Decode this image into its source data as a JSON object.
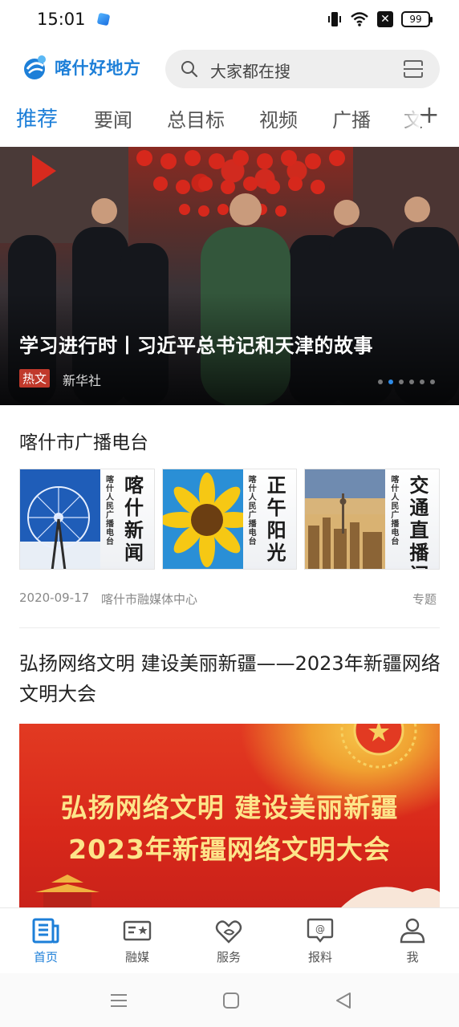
{
  "status_bar": {
    "time": "15:01",
    "battery": "99"
  },
  "header": {
    "logo_text": "喀什好地方",
    "search_placeholder": "大家都在搜"
  },
  "tabs": [
    {
      "label": "推荐",
      "active": true
    },
    {
      "label": "要闻"
    },
    {
      "label": "总目标"
    },
    {
      "label": "视频"
    },
    {
      "label": "广播"
    },
    {
      "label": "文"
    }
  ],
  "tab_add_label": "+",
  "banner": {
    "title": "学习进行时丨习近平总书记和天津的故事",
    "tag": "热文",
    "source": "新华社",
    "dot_count": 6,
    "active_dot": 1
  },
  "radio_section": {
    "title": "喀什市广播电台",
    "cards": [
      {
        "station": "喀什人民广播电台",
        "program": "喀什新闻",
        "icon": "ferris-wheel"
      },
      {
        "station": "喀什人民广播电台",
        "program": "正午阳光",
        "icon": "sunflower"
      },
      {
        "station": "喀什人民广播电台",
        "program": "交通直播间",
        "icon": "city-skyline"
      }
    ],
    "date": "2020-09-17",
    "org": "喀什市融媒体中心",
    "type": "专题"
  },
  "article": {
    "title": "弘扬网络文明 建设美丽新疆——2023年新疆网络文明大会",
    "image_line1": "弘扬网络文明 建设美丽新疆",
    "image_line2": "2023年新疆网络文明大会"
  },
  "bottom_nav": [
    {
      "label": "首页",
      "icon": "home-news-icon",
      "active": true
    },
    {
      "label": "融媒",
      "icon": "media-card-icon"
    },
    {
      "label": "服务",
      "icon": "service-heart-icon"
    },
    {
      "label": "报料",
      "icon": "report-chat-icon"
    },
    {
      "label": "我",
      "icon": "user-icon"
    }
  ],
  "colors": {
    "accent": "#1d7fd8",
    "tag_red": "#c0392b",
    "banner_red": "#d8281a"
  }
}
